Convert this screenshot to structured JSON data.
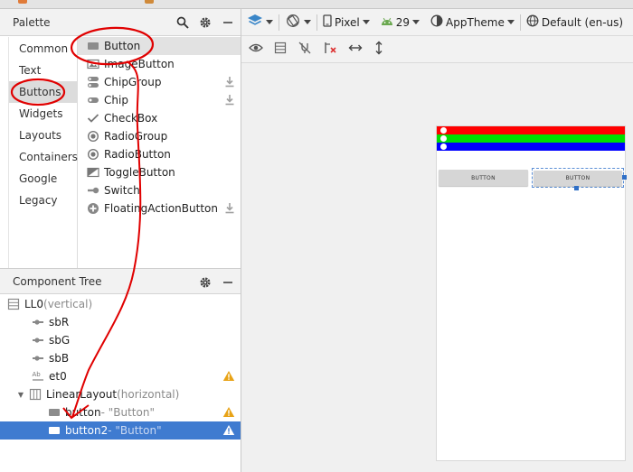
{
  "palette": {
    "title": "Palette",
    "categories": [
      "Common",
      "Text",
      "Buttons",
      "Widgets",
      "Layouts",
      "Containers",
      "Google",
      "Legacy"
    ],
    "selected_category": "Buttons",
    "items": [
      {
        "label": "Button",
        "icon": "button-icon"
      },
      {
        "label": "ImageButton",
        "icon": "image-button-icon"
      },
      {
        "label": "ChipGroup",
        "icon": "chip-group-icon"
      },
      {
        "label": "Chip",
        "icon": "chip-icon"
      },
      {
        "label": "CheckBox",
        "icon": "checkmark-icon"
      },
      {
        "label": "RadioGroup",
        "icon": "radio-group-icon"
      },
      {
        "label": "RadioButton",
        "icon": "radio-button-icon"
      },
      {
        "label": "ToggleButton",
        "icon": "toggle-button-icon"
      },
      {
        "label": "Switch",
        "icon": "switch-icon"
      },
      {
        "label": "FloatingActionButton",
        "icon": "fab-icon"
      }
    ]
  },
  "component_tree": {
    "title": "Component Tree",
    "nodes": [
      {
        "name": "LL0",
        "detail": "(vertical)"
      },
      {
        "name": "sbR",
        "detail": ""
      },
      {
        "name": "sbG",
        "detail": ""
      },
      {
        "name": "sbB",
        "detail": ""
      },
      {
        "name": "et0",
        "detail": ""
      },
      {
        "name": "LinearLayout",
        "detail": "(horizontal)"
      },
      {
        "name": "button",
        "detail": "- \"Button\""
      },
      {
        "name": "button2",
        "detail": "- \"Button\""
      }
    ]
  },
  "toolbar": {
    "device": "Pixel",
    "api_level": "29",
    "theme": "AppTheme",
    "locale": "Default (en-us)"
  },
  "preview": {
    "button1_label": "BUTTON",
    "button2_label": "BUTTON",
    "bar_colors": [
      "#ff0000",
      "#00e000",
      "#0000ff"
    ]
  }
}
